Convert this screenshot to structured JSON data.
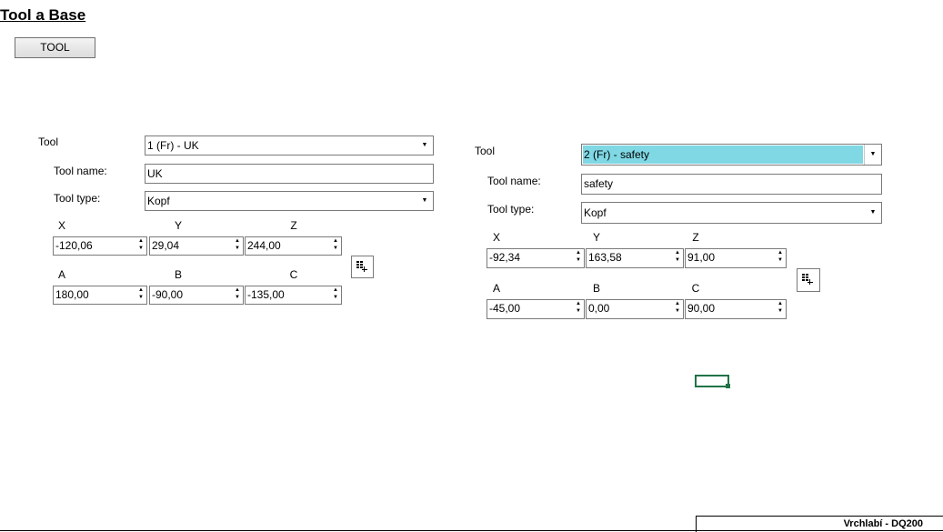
{
  "page": {
    "title": "Tool a Base",
    "tool_button": "TOOL",
    "footer": "Vrchlabí - DQ200"
  },
  "panel_left": {
    "tool_label": "Tool",
    "tool_selected": "1 (Fr) - UK",
    "name_label": "Tool name:",
    "name_value": "UK",
    "type_label": "Tool type:",
    "type_value": "Kopf",
    "axes": {
      "x": "X",
      "y": "Y",
      "z": "Z",
      "a": "A",
      "b": "B",
      "c": "C"
    },
    "values": {
      "x": "-120,06",
      "y": "29,04",
      "z": "244,00",
      "a": "180,00",
      "b": "-90,00",
      "c": "-135,00"
    }
  },
  "panel_right": {
    "tool_label": "Tool",
    "tool_selected": "2 (Fr) - safety",
    "name_label": "Tool name:",
    "name_value": "safety",
    "type_label": "Tool type:",
    "type_value": "Kopf",
    "axes": {
      "x": "X",
      "y": "Y",
      "z": "Z",
      "a": "A",
      "b": "B",
      "c": "C"
    },
    "values": {
      "x": "-92,34",
      "y": "163,58",
      "z": "91,00",
      "a": "-45,00",
      "b": "0,00",
      "c": "90,00"
    }
  },
  "colors": {
    "selection_highlight": "#7fd8e4",
    "active_cell_border": "#217346"
  },
  "icons": {
    "combo_arrow": "▼",
    "spin_up": "▲",
    "spin_down": "▼",
    "grid_button": "grid-add-icon"
  }
}
